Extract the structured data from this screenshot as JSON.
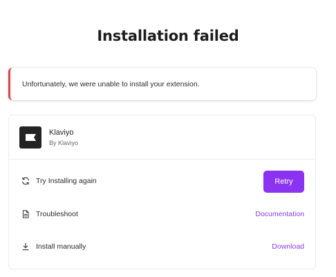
{
  "page": {
    "title": "Installation failed"
  },
  "alert": {
    "message": "Unfortunately, we were unable to install your extension."
  },
  "app": {
    "name": "Klaviyo",
    "by": "By Klaviyo",
    "logo_icon": "klaviyo-flag-logo"
  },
  "actions": {
    "retry": {
      "icon": "refresh-icon",
      "label": "Try Installing again",
      "button": "Retry"
    },
    "troubleshoot": {
      "icon": "document-icon",
      "label": "Troubleshoot",
      "link": "Documentation"
    },
    "manual": {
      "icon": "download-icon",
      "label": "Install manually",
      "link": "Download"
    }
  },
  "colors": {
    "accent": "#8a33f0",
    "link": "#8b3ee8",
    "error": "#d8474b"
  }
}
